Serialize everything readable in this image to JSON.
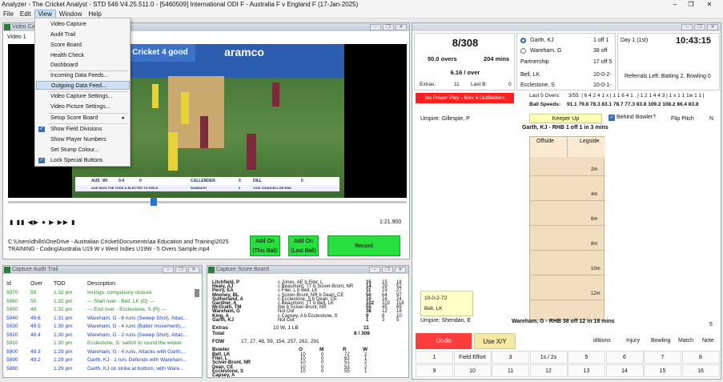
{
  "window": {
    "title": "Analyzer - The Cricket Analyst - STD 546 V4.25.511.0 - [5460509] International ODI F - Australia F v England F (17-Jan-2025)",
    "min": "–",
    "max": "❐",
    "close": "✕"
  },
  "menu": [
    "File",
    "Edit",
    "View",
    "Window",
    "Help"
  ],
  "view_menu": [
    "Video Capture",
    "Audit Trail",
    "Score Board",
    "Health Check",
    "Dashboard",
    "Incoming Data Feeds...",
    "Outgoing Data Feed...",
    "Video Capture Settings...",
    "Video Picture Settings...",
    "Setup Score Board",
    "Show Field Divisions",
    "Show Player Numbers",
    "Set Stump Colour...",
    "Lock Special Buttons"
  ],
  "video": {
    "panel_title": "Video Capture",
    "tab": "Video 1",
    "overlay_logo": "Cricket 4 good",
    "overlay_sponsor": "aramco",
    "bug_team1": "AUS",
    "bug_team2": "WI",
    "bug_score": "0-0",
    "bug_overs": "0",
    "batter1": "CALLENDER",
    "batter1_runs": "0",
    "batter2": "RAMNATH",
    "batter2_runs": "0",
    "bowler": "DILL",
    "bowler_figs": "0",
    "bug_sub": "VICE CHANCELLOR END",
    "bug_left": "AUS WON THE TOSS & ELECTED TO FIELD",
    "time": "1:21.900",
    "path": "C:\\Users\\dhills\\OneDrive - Australian Cricket\\Documents\\aa Education and Training\\2025 TRAINING - Coding\\Australia U19 W v West Indies U19W - 5 Overs Sample.mp4",
    "btn_add_this": "Add On (This Ball)",
    "btn_add_last": "Add On (Last Ball)",
    "btn_record": "Record"
  },
  "audit": {
    "panel_title": "Capture Audit Trail",
    "headers": [
      "Id",
      "Over",
      "TOD",
      "Description"
    ],
    "rows": [
      {
        "id": "5970",
        "over": "50",
        "tod": "1:32 pm",
        "desc": "Innings: compulsory closure",
        "color": "#2a8a2a"
      },
      {
        "id": "5960",
        "over": "50",
        "tod": "1:32 pm",
        "desc": "--- Start over - Bell, LK (O) ---",
        "color": "#2a8a2a"
      },
      {
        "id": "5950",
        "over": "49",
        "tod": "1:32 pm",
        "desc": "--- End over - Ecclestone, S (R) ---",
        "color": "#2a8a2a"
      },
      {
        "id": "5940",
        "over": "49.6",
        "tod": "1:31 pm",
        "desc": "Wareham, G - 6 runs (Sweep Shot), Attac...",
        "color": "#1a3fb0"
      },
      {
        "id": "5930",
        "over": "49.5",
        "tod": "1:30 pm",
        "desc": "Wareham, G - 4 runs (Batter movement),...",
        "color": "#1a3fb0"
      },
      {
        "id": "5920",
        "over": "49.4",
        "tod": "1:30 pm",
        "desc": "Wareham, G - 2 runs (Sweep Shot), Attac...",
        "color": "#1a3fb0"
      },
      {
        "id": "5910",
        "over": "",
        "tod": "1:30 pm",
        "desc": "Ecclestone, S: switch to round the wicket",
        "color": "#2a8a2a"
      },
      {
        "id": "5900",
        "over": "49.3",
        "tod": "1:29 pm",
        "desc": "Wareham, G - 4 runs, Attacks with Garth,...",
        "color": "#1a3fb0"
      },
      {
        "id": "5890",
        "over": "49.2",
        "tod": "1:29 pm",
        "desc": "Garth, KJ - 1 run, Defends with Wareham...",
        "color": "#1a3fb0"
      },
      {
        "id": "5880",
        "over": "",
        "tod": "1:29 pm",
        "desc": "Garth, KJ on strike at bottom, with Ware...",
        "color": "#1a3fb0"
      }
    ]
  },
  "scoreboard": {
    "panel_title": "Capture Score Board",
    "batters": [
      {
        "name": "Litchfield, P",
        "how": "c Jones, AE b Filer, L",
        "r": "15",
        "b": "15",
        "x": "18"
      },
      {
        "name": "Healy, AJ",
        "how": "c Beaumont, TT b Sciver-Brunt, NR",
        "r": "14",
        "b": "29",
        "x": "52"
      },
      {
        "name": "Perry, EA",
        "how": "c Filer, L b Bell, LK",
        "r": "11",
        "b": "19",
        "x": "27"
      },
      {
        "name": "Mooney, BL",
        "how": "c Sciver-Brunt, NR b Dean, CE",
        "r": "50",
        "b": "64",
        "x": "97"
      },
      {
        "name": "Sutherland, A",
        "how": "c Ecclestone, S b Dean, CE",
        "r": "10",
        "b": "16",
        "x": "24"
      },
      {
        "name": "Gardner, A",
        "how": "c Beaumont, TT b Bell, LK",
        "r": "102",
        "b": "102",
        "x": "118"
      },
      {
        "name": "McGrath, TM",
        "how": "lbw b Sciver-Brunt, NR",
        "r": "55",
        "b": "45",
        "x": "69"
      },
      {
        "name": "Wareham, G",
        "how": "Not Out",
        "r": "38",
        "b": "12",
        "x": "18"
      },
      {
        "name": "King, A",
        "how": "c Capsey, A b Ecclestone, S",
        "r": "9",
        "b": "8",
        "x": "10"
      },
      {
        "name": "Garth, KJ",
        "how": "Not Out",
        "r": "1",
        "b": "3",
        "x": "5"
      }
    ],
    "extras_label": "Extras",
    "extras_detail": "10 W, 1 LB",
    "extras": "11",
    "total_label": "Total",
    "total": "8 / 308",
    "fow_label": "FOW",
    "fow": "17, 27, 48, 59, 154, 257, 262, 291",
    "bowl_headers": [
      "Bowler",
      "O",
      "M",
      "R",
      "W"
    ],
    "bowlers": [
      {
        "name": "Bell, LK",
        "o": "10",
        "m": "0",
        "r": "72",
        "w": "2"
      },
      {
        "name": "Filer, L",
        "o": "10",
        "m": "0",
        "r": "62",
        "w": "1"
      },
      {
        "name": "Sciver-Brunt, NR",
        "o": "10",
        "m": "0",
        "r": "51",
        "w": "2"
      },
      {
        "name": "Dean, CE",
        "o": "10",
        "m": "0",
        "r": "53",
        "w": "2"
      },
      {
        "name": "Ecclestone, S",
        "o": "10",
        "m": "0",
        "r": "55",
        "w": "1"
      },
      {
        "name": "Capsey, A",
        "o": "",
        "m": "",
        "r": "",
        "w": ""
      }
    ]
  },
  "match": {
    "score": "8/308",
    "overs": "50.0 overs",
    "mins": "204 mins",
    "rpo": "6.16 / over",
    "extras_label": "Extras:",
    "extras": "11",
    "lastb_label": "Last B:",
    "lastb": "0",
    "striker": "Garth, KJ",
    "striker_figs": "1 off 1",
    "nonstriker": "Wareham, G",
    "nonstriker_figs": "38 off",
    "partnership_label": "Partnership",
    "partnership": "17 off 5",
    "bowler1": "Bell, LK",
    "bowler1_figs": "10-0-2-",
    "bowler2": "Ecclestone, S",
    "bowler2_figs": "10-0-1-",
    "day": "Day 1 (1st)",
    "clock": "10:43:15",
    "referrals": "Referrals Left: Batting 2, Bowling 0",
    "powerplay": "No Power Play - Max 4 Outfielders",
    "last5_label": "Last 5 Overs:",
    "last5": "3/55: | 6 4 2 4 1 x | 1 1 6 4 1 . | 1 2 1 4 4 3 | 1 x 1 1 1w 1 1 |",
    "speeds_label": "Ball Speeds:",
    "speeds": "91.1 79.8 78.3 83.1 78.7 77.3 83.8 109.2 108.2 86.4 83.8",
    "umpire1": "Umpire: Gillespie, P",
    "keeper_btn": "Keeper Up",
    "behind_bowler": "Behind Bowler?",
    "flip_pitch": "Flip Pitch",
    "flip_val": "N",
    "striker_line": "Garth, KJ - RHB   1 off 1 in 3 mins",
    "offside": "Offside",
    "legside": "Legside",
    "distances": [
      "2m",
      "4m",
      "6m",
      "8m",
      "10m",
      "12m"
    ],
    "bowler_box_figs": "10-0-2-72",
    "bowler_box_name": "Bell, LK",
    "umpire2": "Umpire: Sheridan, E",
    "nonstriker_line": "Wareham, G - RHB    38 off 12 in 18 mins",
    "five": "5",
    "undo": "Undo",
    "use_xy": "Use X/Y",
    "tabs": [
      "iditions",
      "Injury",
      "Bowling",
      "Match",
      "Note"
    ],
    "ball_row1": [
      "1",
      "Field Effort",
      "3",
      "1s / 2s",
      "5",
      "6",
      "7",
      "8"
    ],
    "ball_row2": [
      "9",
      "10",
      "11",
      "12",
      "13",
      "14",
      "15",
      "16"
    ]
  }
}
